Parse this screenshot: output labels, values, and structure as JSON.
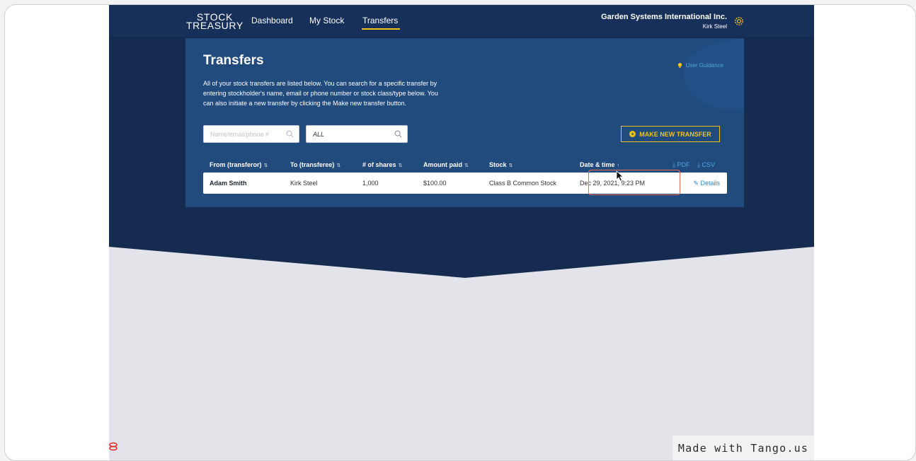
{
  "app": {
    "logo_line1": "STOCK",
    "logo_line2": "TREASURY"
  },
  "nav": {
    "items": [
      {
        "label": "Dashboard"
      },
      {
        "label": "My Stock"
      },
      {
        "label": "Transfers",
        "active": true
      }
    ]
  },
  "account": {
    "company": "Garden Systems International Inc.",
    "user": "Kirk Steel"
  },
  "page": {
    "title": "Transfers",
    "guidance": "User Guidance",
    "description": "All of your stock transfers are listed below. You can search for a specific transfer by entering stockholder's name, email or phone number or stock class/type below. You can also initiate a new transfer by clicking the Make new transfer button.",
    "search_placeholder": "Name/email/phone #",
    "filter_value": "ALL",
    "make_transfer_label": "MAKE NEW TRANSFER"
  },
  "table": {
    "headers": [
      {
        "label": "From (transferor)",
        "sort": "⇅"
      },
      {
        "label": "To (transferee)",
        "sort": "⇅"
      },
      {
        "label": "# of shares",
        "sort": "⇅"
      },
      {
        "label": "Amount paid",
        "sort": "⇅"
      },
      {
        "label": "Stock",
        "sort": "⇅"
      },
      {
        "label": "Date & time",
        "sort": "↑"
      }
    ],
    "export_pdf": "PDF",
    "export_csv": "CSV",
    "rows": [
      {
        "from": "Adam Smith",
        "to": "Kirk Steel",
        "shares": "1,000",
        "amount": "$100.00",
        "stock": "Class B Common Stock",
        "datetime": "Dec 29, 2021, 9:23 PM",
        "action": "Details"
      }
    ]
  },
  "footer": {
    "badge": "Made with Tango.us"
  },
  "colors": {
    "navy": "#17305a",
    "card": "#214a7d",
    "accent_yellow": "#f2c216",
    "link_blue": "#4fa8e0",
    "highlight": "#ea6a4f"
  }
}
